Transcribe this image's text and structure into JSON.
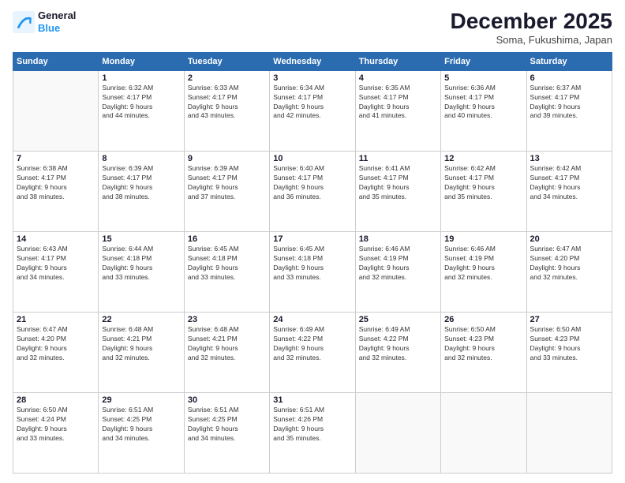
{
  "logo": {
    "line1": "General",
    "line2": "Blue"
  },
  "header": {
    "month": "December 2025",
    "location": "Soma, Fukushima, Japan"
  },
  "days_of_week": [
    "Sunday",
    "Monday",
    "Tuesday",
    "Wednesday",
    "Thursday",
    "Friday",
    "Saturday"
  ],
  "weeks": [
    [
      {
        "day": "",
        "info": ""
      },
      {
        "day": "1",
        "info": "Sunrise: 6:32 AM\nSunset: 4:17 PM\nDaylight: 9 hours\nand 44 minutes."
      },
      {
        "day": "2",
        "info": "Sunrise: 6:33 AM\nSunset: 4:17 PM\nDaylight: 9 hours\nand 43 minutes."
      },
      {
        "day": "3",
        "info": "Sunrise: 6:34 AM\nSunset: 4:17 PM\nDaylight: 9 hours\nand 42 minutes."
      },
      {
        "day": "4",
        "info": "Sunrise: 6:35 AM\nSunset: 4:17 PM\nDaylight: 9 hours\nand 41 minutes."
      },
      {
        "day": "5",
        "info": "Sunrise: 6:36 AM\nSunset: 4:17 PM\nDaylight: 9 hours\nand 40 minutes."
      },
      {
        "day": "6",
        "info": "Sunrise: 6:37 AM\nSunset: 4:17 PM\nDaylight: 9 hours\nand 39 minutes."
      }
    ],
    [
      {
        "day": "7",
        "info": "Sunrise: 6:38 AM\nSunset: 4:17 PM\nDaylight: 9 hours\nand 38 minutes."
      },
      {
        "day": "8",
        "info": "Sunrise: 6:39 AM\nSunset: 4:17 PM\nDaylight: 9 hours\nand 38 minutes."
      },
      {
        "day": "9",
        "info": "Sunrise: 6:39 AM\nSunset: 4:17 PM\nDaylight: 9 hours\nand 37 minutes."
      },
      {
        "day": "10",
        "info": "Sunrise: 6:40 AM\nSunset: 4:17 PM\nDaylight: 9 hours\nand 36 minutes."
      },
      {
        "day": "11",
        "info": "Sunrise: 6:41 AM\nSunset: 4:17 PM\nDaylight: 9 hours\nand 35 minutes."
      },
      {
        "day": "12",
        "info": "Sunrise: 6:42 AM\nSunset: 4:17 PM\nDaylight: 9 hours\nand 35 minutes."
      },
      {
        "day": "13",
        "info": "Sunrise: 6:42 AM\nSunset: 4:17 PM\nDaylight: 9 hours\nand 34 minutes."
      }
    ],
    [
      {
        "day": "14",
        "info": "Sunrise: 6:43 AM\nSunset: 4:17 PM\nDaylight: 9 hours\nand 34 minutes."
      },
      {
        "day": "15",
        "info": "Sunrise: 6:44 AM\nSunset: 4:18 PM\nDaylight: 9 hours\nand 33 minutes."
      },
      {
        "day": "16",
        "info": "Sunrise: 6:45 AM\nSunset: 4:18 PM\nDaylight: 9 hours\nand 33 minutes."
      },
      {
        "day": "17",
        "info": "Sunrise: 6:45 AM\nSunset: 4:18 PM\nDaylight: 9 hours\nand 33 minutes."
      },
      {
        "day": "18",
        "info": "Sunrise: 6:46 AM\nSunset: 4:19 PM\nDaylight: 9 hours\nand 32 minutes."
      },
      {
        "day": "19",
        "info": "Sunrise: 6:46 AM\nSunset: 4:19 PM\nDaylight: 9 hours\nand 32 minutes."
      },
      {
        "day": "20",
        "info": "Sunrise: 6:47 AM\nSunset: 4:20 PM\nDaylight: 9 hours\nand 32 minutes."
      }
    ],
    [
      {
        "day": "21",
        "info": "Sunrise: 6:47 AM\nSunset: 4:20 PM\nDaylight: 9 hours\nand 32 minutes."
      },
      {
        "day": "22",
        "info": "Sunrise: 6:48 AM\nSunset: 4:21 PM\nDaylight: 9 hours\nand 32 minutes."
      },
      {
        "day": "23",
        "info": "Sunrise: 6:48 AM\nSunset: 4:21 PM\nDaylight: 9 hours\nand 32 minutes."
      },
      {
        "day": "24",
        "info": "Sunrise: 6:49 AM\nSunset: 4:22 PM\nDaylight: 9 hours\nand 32 minutes."
      },
      {
        "day": "25",
        "info": "Sunrise: 6:49 AM\nSunset: 4:22 PM\nDaylight: 9 hours\nand 32 minutes."
      },
      {
        "day": "26",
        "info": "Sunrise: 6:50 AM\nSunset: 4:23 PM\nDaylight: 9 hours\nand 32 minutes."
      },
      {
        "day": "27",
        "info": "Sunrise: 6:50 AM\nSunset: 4:23 PM\nDaylight: 9 hours\nand 33 minutes."
      }
    ],
    [
      {
        "day": "28",
        "info": "Sunrise: 6:50 AM\nSunset: 4:24 PM\nDaylight: 9 hours\nand 33 minutes."
      },
      {
        "day": "29",
        "info": "Sunrise: 6:51 AM\nSunset: 4:25 PM\nDaylight: 9 hours\nand 34 minutes."
      },
      {
        "day": "30",
        "info": "Sunrise: 6:51 AM\nSunset: 4:25 PM\nDaylight: 9 hours\nand 34 minutes."
      },
      {
        "day": "31",
        "info": "Sunrise: 6:51 AM\nSunset: 4:26 PM\nDaylight: 9 hours\nand 35 minutes."
      },
      {
        "day": "",
        "info": ""
      },
      {
        "day": "",
        "info": ""
      },
      {
        "day": "",
        "info": ""
      }
    ]
  ]
}
